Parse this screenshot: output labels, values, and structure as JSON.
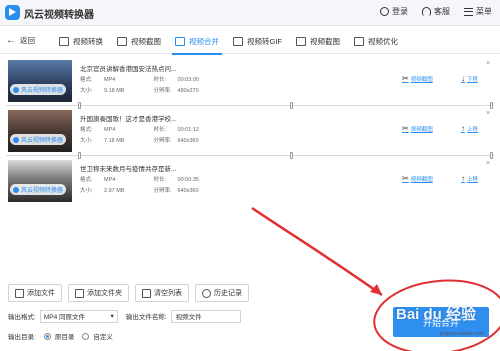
{
  "app": {
    "title": "风云视频转换器"
  },
  "titlebar": {
    "login": "登录",
    "service": "客服",
    "menu": "菜单"
  },
  "nav": {
    "back": "返回",
    "tabs": [
      {
        "label": "视频转换",
        "active": false
      },
      {
        "label": "视频截图",
        "active": false
      },
      {
        "label": "视频合并",
        "active": true
      },
      {
        "label": "视频转GIF",
        "active": false
      },
      {
        "label": "视频截图",
        "active": false
      },
      {
        "label": "视频优化",
        "active": false
      }
    ]
  },
  "labels": {
    "format": "格式:",
    "duration": "时长:",
    "size": "大小:",
    "resolution": "分辨率:",
    "cut": "视频截图",
    "down": "下移",
    "up": "上移"
  },
  "files": [
    {
      "name": "北京官员讲解香港国安法热点问...",
      "format": "MP4",
      "duration": "00:03:00",
      "size": "9.18 MB",
      "resolution": "480x270",
      "move": "down"
    },
    {
      "name": "升国旗奏国歌！这才是香港学校...",
      "format": "MP4",
      "duration": "00:01:12",
      "size": "7.18 MB",
      "resolution": "640x360",
      "move": "up"
    },
    {
      "name": "世卫称未来数月与疫情共存是新...",
      "format": "MP4",
      "duration": "00:00:35",
      "size": "2.97 MB",
      "resolution": "640x360",
      "move": "up"
    }
  ],
  "watermark": "风云视频转换器",
  "toolbar": {
    "add_file": "添加文件",
    "add_folder": "添加文件夹",
    "clear_list": "清空列表",
    "history": "历史记录"
  },
  "output": {
    "format_label": "输出格式:",
    "format_value": "MP4 同原文件",
    "name_label": "输出文件名称:",
    "name_value": "视频文件",
    "dir_label": "输出目录:",
    "dir_original": "原目录",
    "dir_custom": "自定义"
  },
  "start_button": "开始合并",
  "baidu": {
    "logo": "Bai du 经验",
    "url": "jingyan.baidu.com"
  },
  "colors": {
    "accent": "#2a8ef0",
    "annotation": "#e03030"
  }
}
